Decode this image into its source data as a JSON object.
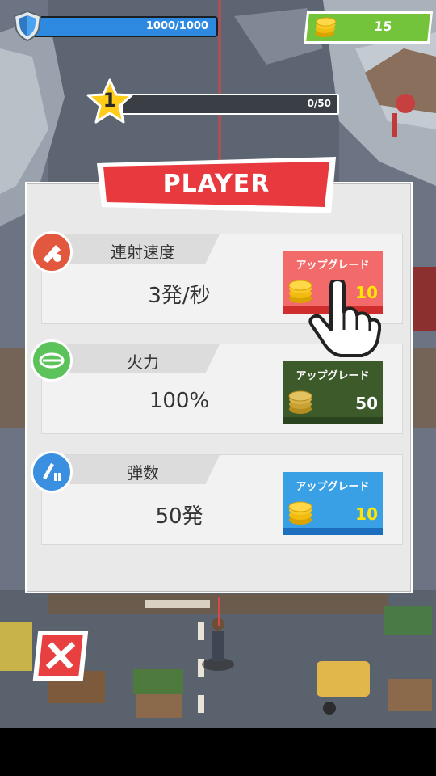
{
  "hud": {
    "health_text": "1000/1000",
    "health_fraction": 1.0,
    "coins": "15",
    "level": "1",
    "xp_text": "0/50",
    "xp_fraction": 0.0
  },
  "panel": {
    "title": "PLAYER",
    "stats": [
      {
        "label": "連射速度",
        "value": "3発/秒",
        "button_label": "アップグレード",
        "price": "10",
        "button_color": "#f26a6a",
        "strip_color": "#d02d2d",
        "price_color": "#ffe600",
        "icon_color": "#e2583e",
        "icon": "fire-rate-icon",
        "affordable": true
      },
      {
        "label": "火力",
        "value": "100%",
        "button_label": "アップグレード",
        "price": "50",
        "button_color": "#3c5a2a",
        "strip_color": "#2a4420",
        "price_color": "#ffffff",
        "icon_color": "#5cc35a",
        "icon": "firepower-icon",
        "affordable": false
      },
      {
        "label": "弾数",
        "value": "50発",
        "button_label": "アップグレード",
        "price": "10",
        "button_color": "#3aa0e6",
        "strip_color": "#1c6fbf",
        "price_color": "#ffe600",
        "icon_color": "#3a8fe0",
        "icon": "ammo-icon",
        "affordable": true
      }
    ]
  },
  "colors": {
    "ribbon": "#e8393e",
    "coin_box": "#73c33b",
    "hp_fill": "#2d8ae0",
    "close": "#e84040"
  }
}
